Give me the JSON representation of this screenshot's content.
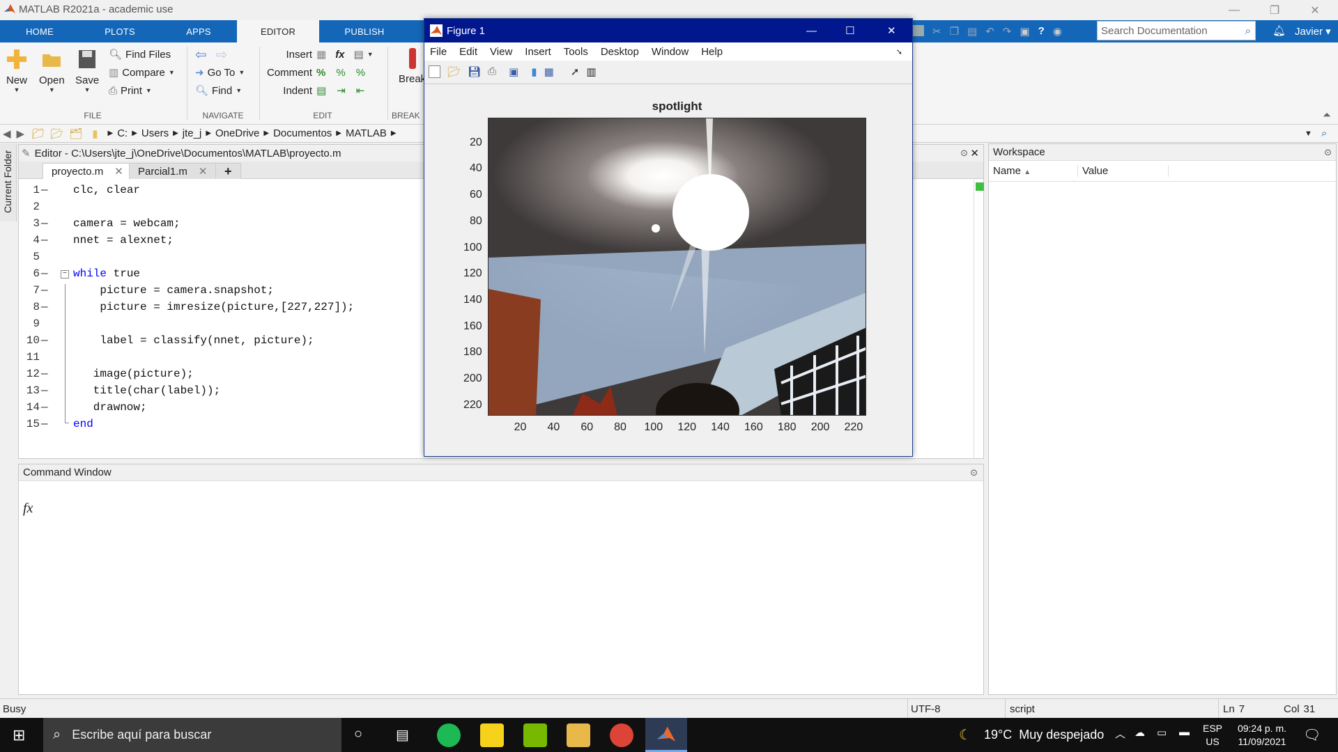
{
  "window": {
    "title": "MATLAB R2021a - academic use"
  },
  "tabs": [
    "HOME",
    "PLOTS",
    "APPS",
    "EDITOR",
    "PUBLISH"
  ],
  "ribbon": {
    "new": "New",
    "open": "Open",
    "save": "Save",
    "find_files": "Find Files",
    "compare": "Compare",
    "print": "Print",
    "goto": "Go To",
    "find": "Find",
    "insert": "Insert",
    "comment": "Comment",
    "indent": "Indent",
    "breakpoints": "Break",
    "groups": {
      "file": "FILE",
      "navigate": "NAVIGATE",
      "edit": "EDIT",
      "breakpoints": "BREAK"
    }
  },
  "search": {
    "placeholder": "Search Documentation"
  },
  "user": "Javier",
  "breadcrumb": [
    "C:",
    "Users",
    "jte_j",
    "OneDrive",
    "Documentos",
    "MATLAB"
  ],
  "side": {
    "current_folder": "Current Folder"
  },
  "editor": {
    "header": "Editor - C:\\Users\\jte_j\\OneDrive\\Documentos\\MATLAB\\proyecto.m",
    "tabs": [
      "proyecto.m",
      "Parcial1.m",
      "+"
    ],
    "lines": [
      {
        "n": "1",
        "dash": "—",
        "text": "clc, clear",
        "indent": 0,
        "kw": ""
      },
      {
        "n": "2",
        "dash": "",
        "text": "",
        "indent": 0,
        "kw": ""
      },
      {
        "n": "3",
        "dash": "—",
        "text": "camera = webcam;",
        "indent": 0,
        "kw": ""
      },
      {
        "n": "4",
        "dash": "—",
        "text": "nnet = alexnet;",
        "indent": 0,
        "kw": ""
      },
      {
        "n": "5",
        "dash": "",
        "text": "",
        "indent": 0,
        "kw": ""
      },
      {
        "n": "6",
        "dash": "—",
        "text": " true",
        "indent": 0,
        "kw": "while"
      },
      {
        "n": "7",
        "dash": "—",
        "text": "picture = camera.snapshot;",
        "indent": 4,
        "kw": ""
      },
      {
        "n": "8",
        "dash": "—",
        "text": "picture = imresize(picture,[227,227]);",
        "indent": 4,
        "kw": ""
      },
      {
        "n": "9",
        "dash": "",
        "text": "",
        "indent": 0,
        "kw": ""
      },
      {
        "n": "10",
        "dash": "—",
        "text": "label = classify(nnet, picture);",
        "indent": 4,
        "kw": ""
      },
      {
        "n": "11",
        "dash": "",
        "text": "",
        "indent": 0,
        "kw": ""
      },
      {
        "n": "12",
        "dash": "—",
        "text": "image(picture);",
        "indent": 3,
        "kw": ""
      },
      {
        "n": "13",
        "dash": "—",
        "text": "title(char(label));",
        "indent": 3,
        "kw": ""
      },
      {
        "n": "14",
        "dash": "—",
        "text": "drawnow;",
        "indent": 3,
        "kw": ""
      },
      {
        "n": "15",
        "dash": "—",
        "text": "",
        "indent": 0,
        "kw": "end"
      }
    ]
  },
  "command": {
    "title": "Command Window",
    "prompt": "fx"
  },
  "workspace": {
    "title": "Workspace",
    "col_name": "Name",
    "col_value": "Value"
  },
  "figure": {
    "title": "Figure 1",
    "menu": [
      "File",
      "Edit",
      "View",
      "Insert",
      "Tools",
      "Desktop",
      "Window",
      "Help"
    ],
    "plot_title": "spotlight",
    "yticks": [
      "20",
      "40",
      "60",
      "80",
      "100",
      "120",
      "140",
      "160",
      "180",
      "200",
      "220"
    ],
    "xticks": [
      "20",
      "40",
      "60",
      "80",
      "100",
      "120",
      "140",
      "160",
      "180",
      "200",
      "220"
    ]
  },
  "status": {
    "state": "Busy",
    "encoding": "UTF-8",
    "type": "script",
    "ln_label": "Ln",
    "ln": "7",
    "col_label": "Col",
    "col": "31"
  },
  "taskbar": {
    "search": "Escribe aquí para buscar",
    "weather": "19°C  Muy despejado",
    "lang1": "ESP",
    "lang2": "US",
    "time": "09:24 p. m.",
    "date": "11/09/2021"
  },
  "colors": {
    "tab_blue": "#1466b8",
    "fig_title": "#00178e",
    "keyword": "#0000ff"
  }
}
